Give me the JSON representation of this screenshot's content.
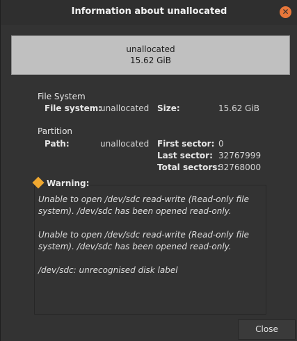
{
  "window": {
    "title": "Information about unallocated",
    "close_glyph": "✕"
  },
  "preview": {
    "name": "unallocated",
    "size": "15.62 GiB"
  },
  "file_system": {
    "heading": "File System",
    "fs_label": "File system:",
    "fs_value": "unallocated",
    "size_label": "Size:",
    "size_value": "15.62 GiB"
  },
  "partition": {
    "heading": "Partition",
    "path_label": "Path:",
    "path_value": "unallocated",
    "first_sector_label": "First sector:",
    "first_sector_value": "0",
    "last_sector_label": "Last sector:",
    "last_sector_value": "32767999",
    "total_sectors_label": "Total sectors:",
    "total_sectors_value": "32768000"
  },
  "warning": {
    "heading": "Warning:",
    "messages": [
      "Unable to open /dev/sdc read-write (Read-only file system).  /dev/sdc has been opened read-only.",
      "Unable to open /dev/sdc read-write (Read-only file system).  /dev/sdc has been opened read-only.",
      "/dev/sdc: unrecognised disk label"
    ]
  },
  "buttons": {
    "close_label": "Close"
  },
  "colors": {
    "accent": "#e8773a",
    "warning_icon": "#f0a830",
    "preview_bg": "#c0c0c0"
  }
}
